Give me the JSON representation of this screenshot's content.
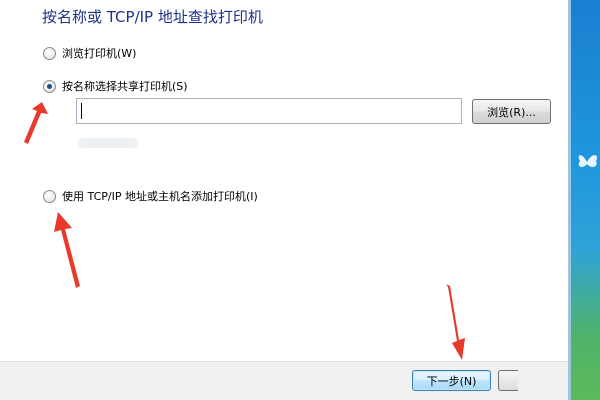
{
  "dialog": {
    "title": "按名称或 TCP/IP 地址查找打印机",
    "options": [
      {
        "label": "浏览打印机(W)",
        "checked": false
      },
      {
        "label": "按名称选择共享打印机(S)",
        "checked": true
      },
      {
        "label": "使用 TCP/IP 地址或主机名添加打印机(I)",
        "checked": false
      }
    ],
    "printer_input": {
      "value": "",
      "placeholder": ""
    },
    "browse_label": "浏览(R)...",
    "next_label": "下一步(N)"
  },
  "watermark": "",
  "colors": {
    "title": "#1e3287",
    "annotation_arrow": "#e8392b",
    "footer": "#f0f0f0",
    "next_button": "#bee6fd",
    "desktop": "#1e95de"
  },
  "icons": [
    "radio-unchecked-icon",
    "radio-checked-icon",
    "annotation-arrow-icon",
    "butterfly-icon"
  ]
}
